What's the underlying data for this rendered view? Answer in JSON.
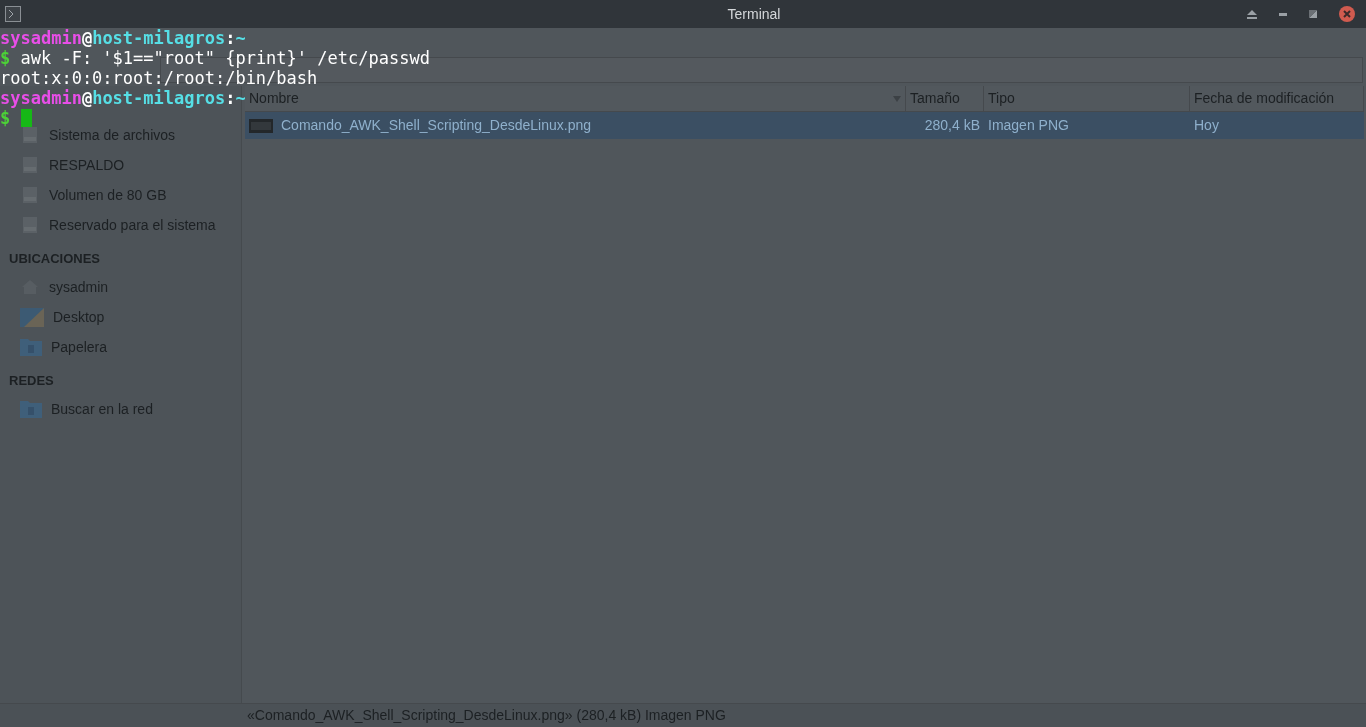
{
  "window": {
    "title": "Terminal"
  },
  "file_manager": {
    "sidebar": [
      {
        "items": [
          {
            "kind": "drive",
            "label": "Sistema de archivos"
          },
          {
            "kind": "drive",
            "label": "RESPALDO"
          },
          {
            "kind": "drive",
            "label": "Volumen de 80 GB"
          },
          {
            "kind": "drive",
            "label": "Reservado para el sistema"
          }
        ]
      },
      {
        "heading": "UBICACIONES",
        "items": [
          {
            "kind": "home",
            "label": "sysadmin"
          },
          {
            "kind": "desktop",
            "label": "Desktop"
          },
          {
            "kind": "folder",
            "label": "Papelera"
          }
        ]
      },
      {
        "heading": "REDES",
        "items": [
          {
            "kind": "folder",
            "label": "Buscar en la red"
          }
        ]
      }
    ],
    "columns": [
      {
        "label": "Nombre",
        "sorted": true
      },
      {
        "label": "Tamaño",
        "sorted": false
      },
      {
        "label": "Tipo",
        "sorted": false
      },
      {
        "label": "Fecha de modificación",
        "sorted": false
      }
    ],
    "rows": [
      {
        "selected": true,
        "cells": [
          "Comando_AWK_Shell_Scripting_DesdeLinux.png",
          "280,4 kB",
          "Imagen PNG",
          "Hoy"
        ]
      }
    ],
    "status_bar": "«Comando_AWK_Shell_Scripting_DesdeLinux.png» (280,4 kB) Imagen PNG"
  },
  "terminal": [
    {
      "kind": "prompt",
      "user": "sysadmin",
      "at": "@",
      "host": "host-milagros",
      "colon": ":",
      "path": "~"
    },
    {
      "kind": "command",
      "symbol": "$",
      "text": "awk -F: '$1==\"root\" {print}' /etc/passwd"
    },
    {
      "kind": "output",
      "text": "root:x:0:0:root:/root:/bin/bash"
    },
    {
      "kind": "prompt",
      "user": "sysadmin",
      "at": "@",
      "host": "host-milagros",
      "colon": ":",
      "path": "~"
    },
    {
      "kind": "command",
      "symbol": "$",
      "cursor": true
    }
  ]
}
